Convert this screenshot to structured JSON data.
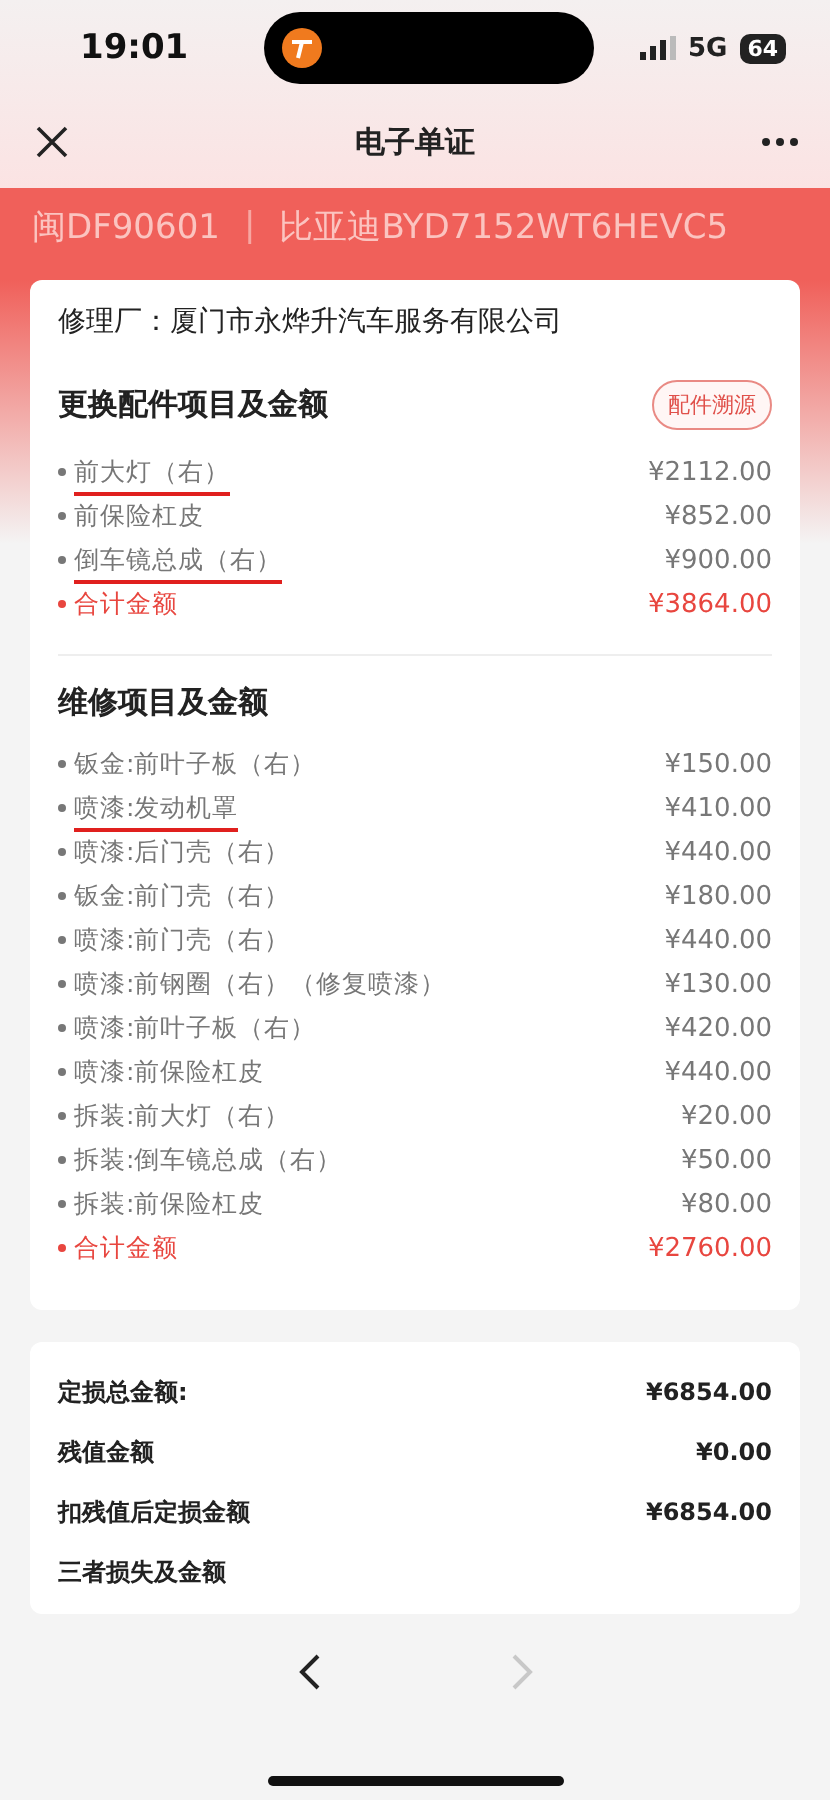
{
  "status_bar": {
    "time": "19:01",
    "network": "5G",
    "battery": "64"
  },
  "nav": {
    "title": "电子单证"
  },
  "vehicle": {
    "plate": "闽DF90601",
    "separator": "|",
    "model": "比亚迪BYD7152WT6HEVC5"
  },
  "shop": {
    "label": "修理厂：",
    "name": "厦门市永烨升汽车服务有限公司"
  },
  "parts": {
    "title": "更换配件项目及金额",
    "action": "配件溯源",
    "items": [
      {
        "name": "前大灯（右）",
        "amount": "¥2112.00",
        "marked": true,
        "kind": "item"
      },
      {
        "name": "前保险杠皮",
        "amount": "¥852.00",
        "marked": false,
        "kind": "item"
      },
      {
        "name": "倒车镜总成（右）",
        "amount": "¥900.00",
        "marked": true,
        "kind": "item"
      },
      {
        "name": "合计金额",
        "amount": "¥3864.00",
        "marked": false,
        "kind": "total"
      }
    ]
  },
  "repairs": {
    "title": "维修项目及金额",
    "items": [
      {
        "name": "钣金:前叶子板（右）",
        "amount": "¥150.00",
        "marked": false,
        "kind": "item"
      },
      {
        "name": "喷漆:发动机罩",
        "amount": "¥410.00",
        "marked": true,
        "kind": "item"
      },
      {
        "name": "喷漆:后门壳（右）",
        "amount": "¥440.00",
        "marked": false,
        "kind": "item"
      },
      {
        "name": "钣金:前门壳（右）",
        "amount": "¥180.00",
        "marked": false,
        "kind": "item"
      },
      {
        "name": "喷漆:前门壳（右）",
        "amount": "¥440.00",
        "marked": false,
        "kind": "item"
      },
      {
        "name": "喷漆:前钢圈（右）（修复喷漆）",
        "amount": "¥130.00",
        "marked": false,
        "kind": "item"
      },
      {
        "name": "喷漆:前叶子板（右）",
        "amount": "¥420.00",
        "marked": false,
        "kind": "item"
      },
      {
        "name": "喷漆:前保险杠皮",
        "amount": "¥440.00",
        "marked": false,
        "kind": "item"
      },
      {
        "name": "拆装:前大灯（右）",
        "amount": "¥20.00",
        "marked": false,
        "kind": "item"
      },
      {
        "name": "拆装:倒车镜总成（右）",
        "amount": "¥50.00",
        "marked": false,
        "kind": "item"
      },
      {
        "name": "拆装:前保险杠皮",
        "amount": "¥80.00",
        "marked": false,
        "kind": "item"
      },
      {
        "name": "合计金额",
        "amount": "¥2760.00",
        "marked": false,
        "kind": "total"
      }
    ]
  },
  "summary": [
    {
      "label": "定损总金额:",
      "amount": "¥6854.00"
    },
    {
      "label": "残值金额",
      "amount": "¥0.00"
    },
    {
      "label": "扣残值后定损金额",
      "amount": "¥6854.00"
    },
    {
      "label": "三者损失及金额"
    }
  ],
  "bottom_nav": [
    {
      "kind": "back",
      "disabled": false
    },
    {
      "kind": "forward",
      "disabled": true
    }
  ]
}
